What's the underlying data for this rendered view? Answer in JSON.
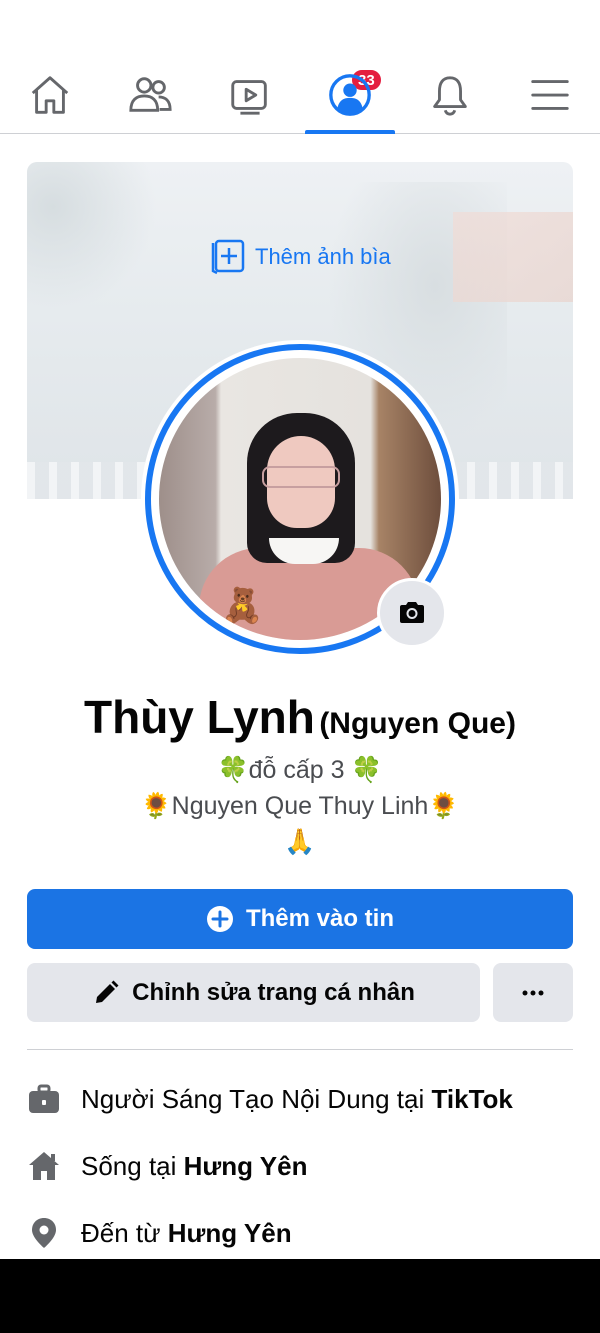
{
  "nav": {
    "tabs": [
      {
        "name": "home",
        "icon": "home-icon"
      },
      {
        "name": "friends",
        "icon": "friends-icon"
      },
      {
        "name": "watch",
        "icon": "video-icon",
        "badge": "33"
      },
      {
        "name": "profile",
        "icon": "profile-icon",
        "active": true
      },
      {
        "name": "notifications",
        "icon": "bell-icon"
      },
      {
        "name": "menu",
        "icon": "menu-icon"
      }
    ]
  },
  "cover": {
    "add_cover_label": "Thêm ảnh bìa"
  },
  "profile": {
    "name": "Thùy Lynh",
    "alt_name": "(Nguyen Que)",
    "bio_line1": "🍀đỗ cấp 3 🍀",
    "bio_line2": "🌻Nguyen Que Thuy Linh🌻",
    "bio_line3": "🙏"
  },
  "actions": {
    "add_story": "Thêm vào tin",
    "edit_profile": "Chỉnh sửa trang cá nhân"
  },
  "details": {
    "work_prefix": "Người Sáng Tạo Nội Dung tại ",
    "work_place": "TikTok",
    "lives_prefix": "Sống tại ",
    "lives_place": "Hưng Yên",
    "from_prefix": "Đến từ ",
    "from_place": "Hưng Yên"
  },
  "colors": {
    "accent": "#1877f2",
    "badge": "#e41e3f",
    "button_gray": "#e4e6eb"
  }
}
